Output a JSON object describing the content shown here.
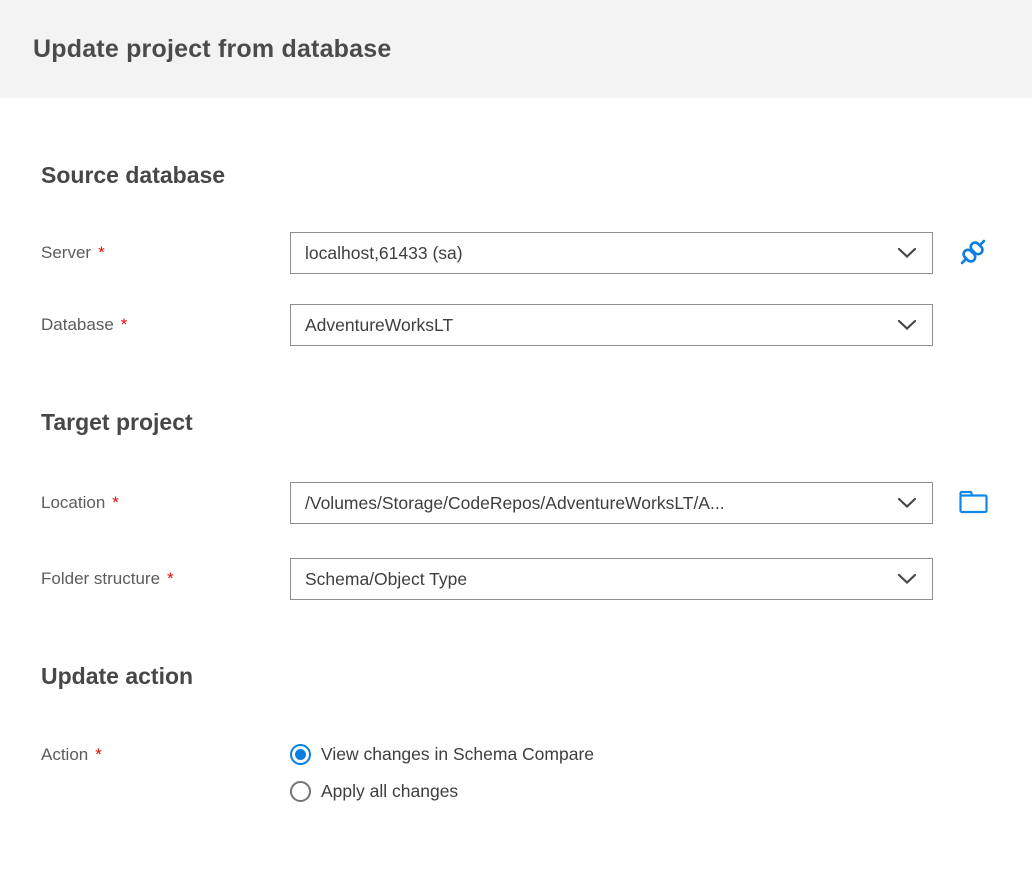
{
  "header": {
    "title": "Update project from database"
  },
  "required_marker": "*",
  "colors": {
    "accent_blue": "#0c7edf",
    "required_red": "#e00b0b",
    "header_bg": "#f3f3f3",
    "border_gray": "#8e8e8e"
  },
  "icons": {
    "connect": "connect-plug-icon",
    "folder": "folder-icon",
    "chevron": "chevron-down-icon"
  },
  "sections": [
    {
      "heading": "Source database",
      "fields": [
        {
          "label": "Server",
          "required": true,
          "type": "dropdown",
          "value": "localhost,61433 (sa)",
          "trailing_icon": "connect-plug-icon"
        },
        {
          "label": "Database",
          "required": true,
          "type": "dropdown",
          "value": "AdventureWorksLT"
        }
      ]
    },
    {
      "heading": "Target project",
      "fields": [
        {
          "label": "Location",
          "required": true,
          "type": "dropdown",
          "value": "/Volumes/Storage/CodeRepos/AdventureWorksLT/A...",
          "trailing_icon": "folder-icon"
        },
        {
          "label": "Folder structure",
          "required": true,
          "type": "dropdown",
          "value": "Schema/Object Type"
        }
      ]
    },
    {
      "heading": "Update action",
      "fields": [
        {
          "label": "Action",
          "required": true,
          "type": "radio-group",
          "options": [
            {
              "label": "View changes in Schema Compare",
              "selected": true
            },
            {
              "label": "Apply all changes",
              "selected": false
            }
          ]
        }
      ]
    }
  ]
}
